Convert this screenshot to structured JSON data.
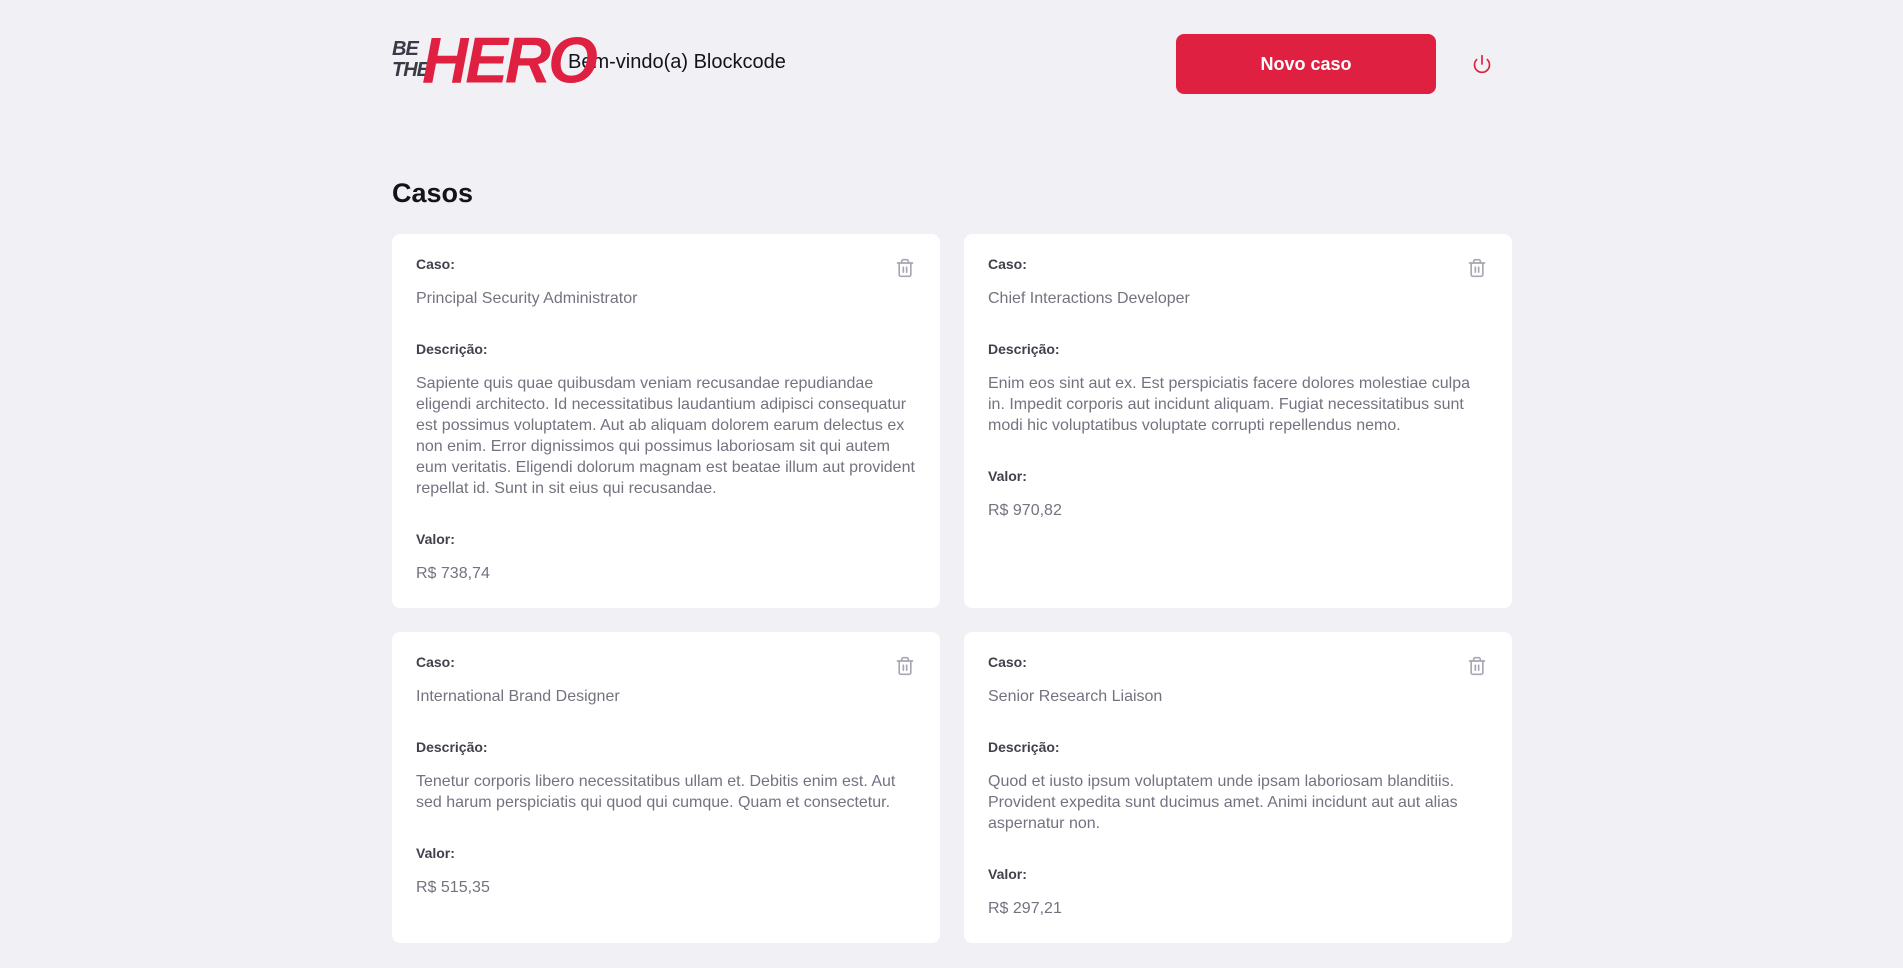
{
  "header": {
    "logo_small": "BE THE",
    "logo_big": "HERO",
    "welcome": "Bem-vindo(a) Blockcode",
    "new_case_label": "Novo caso",
    "logout_icon": "power-icon"
  },
  "main": {
    "title": "Casos",
    "labels": {
      "case": "Caso:",
      "description": "Descrição:",
      "value": "Valor:"
    },
    "cases": [
      {
        "title": "Principal Security Administrator",
        "description": "Sapiente quis quae quibusdam veniam recusandae repudiandae eligendi architecto. Id necessitatibus laudantium adipisci consequatur est possimus voluptatem. Aut ab aliquam dolorem earum delectus ex non enim. Error dignissimos qui possimus laboriosam sit qui autem eum veritatis. Eligendi dolorum magnam est beatae illum aut provident repellat id. Sunt in sit eius qui recusandae.",
        "value": "R$ 738,74"
      },
      {
        "title": "Chief Interactions Developer",
        "description": "Enim eos sint aut ex. Est perspiciatis facere dolores molestiae culpa in. Impedit corporis aut incidunt aliquam. Fugiat necessitatibus sunt modi hic voluptatibus voluptate corrupti repellendus nemo.",
        "value": "R$ 970,82"
      },
      {
        "title": "International Brand Designer",
        "description": "Tenetur corporis libero necessitatibus ullam et. Debitis enim est. Aut sed harum perspiciatis qui quod qui cumque. Quam et consectetur.",
        "value": "R$ 515,35"
      },
      {
        "title": "Senior Research Liaison",
        "description": "Quod et iusto ipsum voluptatem unde ipsam laboriosam blanditiis. Provident expedita sunt ducimus amet. Animi incidunt aut aut alias aspernatur non.",
        "value": "R$ 297,21"
      }
    ]
  },
  "colors": {
    "accent": "#e02041",
    "background": "#f0f0f5",
    "card": "#ffffff",
    "muted_text": "#737380",
    "label_text": "#41414d",
    "trash_icon": "#a8a8b3"
  }
}
